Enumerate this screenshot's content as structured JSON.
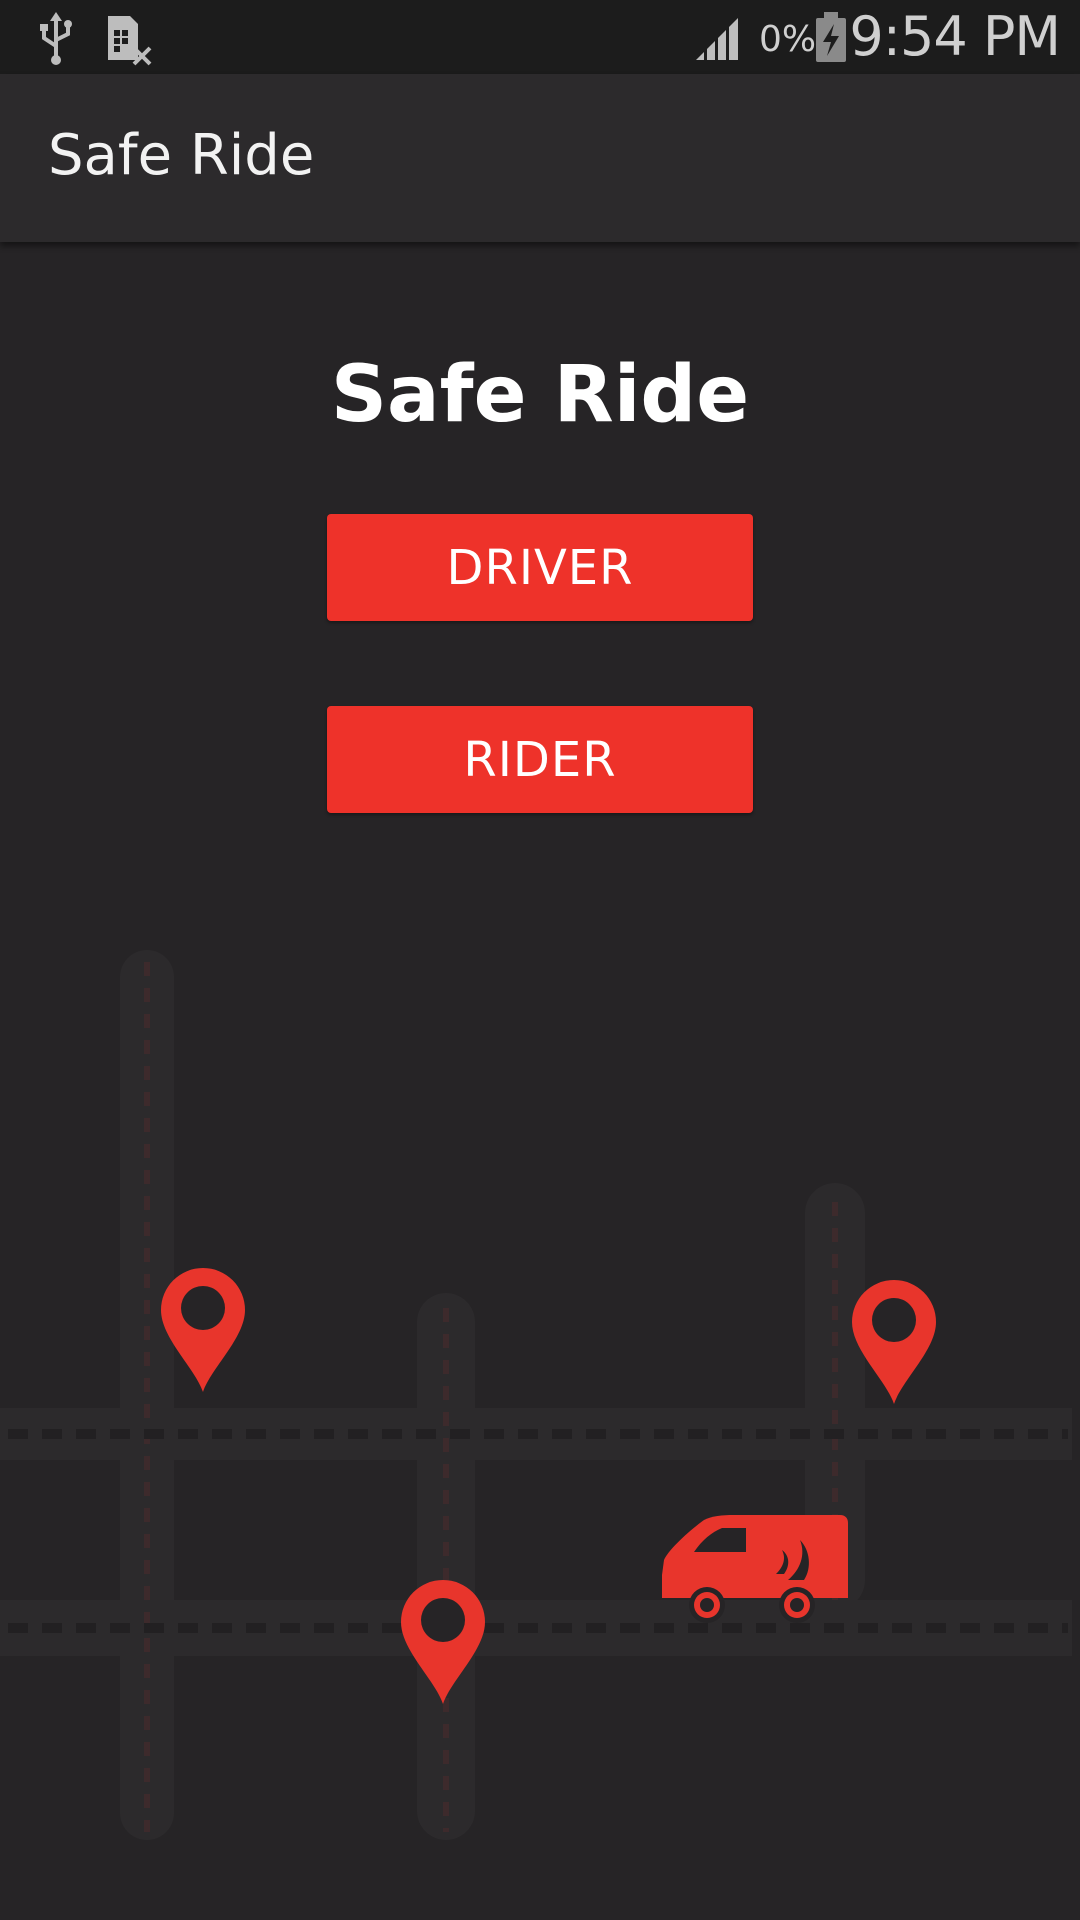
{
  "status_bar": {
    "time": "9:54 PM",
    "battery_percent": "0%",
    "icons": [
      "usb-icon",
      "sim-missing-icon",
      "signal-icon",
      "battery-charging-icon"
    ]
  },
  "app_bar": {
    "title": "Safe Ride"
  },
  "main": {
    "title": "Safe Ride",
    "driver_label": "DRIVER",
    "rider_label": "RIDER"
  },
  "illustration": {
    "icons": [
      "map-pin-icon",
      "map-pin-icon",
      "map-pin-icon",
      "van-icon"
    ]
  },
  "colors": {
    "background": "#262426",
    "app_bar": "#2c2a2c",
    "status_bar": "#1c1c1c",
    "accent": "#ee322a",
    "road": "#2c2a2c"
  }
}
